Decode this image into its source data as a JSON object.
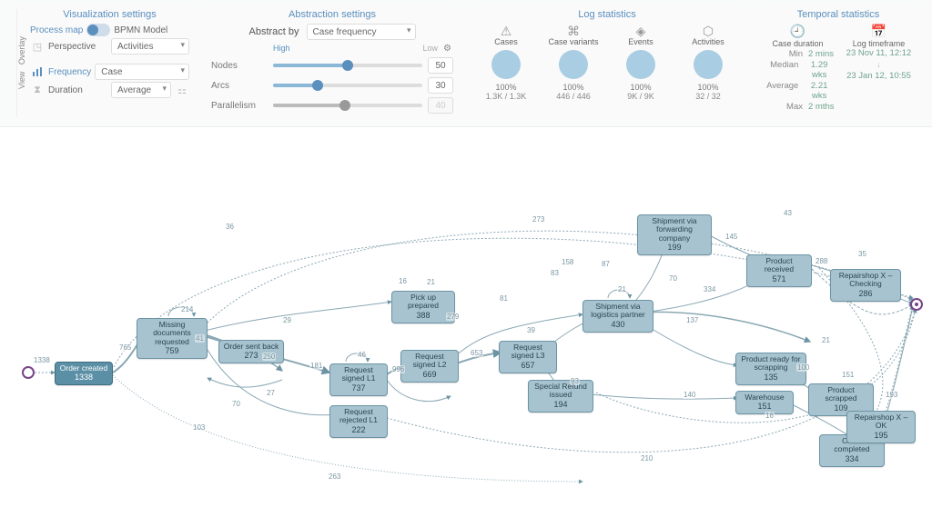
{
  "vis": {
    "title": "Visualization settings",
    "process_map": "Process map",
    "bpmn_model": "BPMN Model",
    "perspective_label": "Perspective",
    "perspective_value": "Activities",
    "view_tab": "View",
    "overlay_tab": "Overlay",
    "frequency": "Frequency",
    "frequency_value": "Case",
    "duration": "Duration",
    "duration_value": "Average"
  },
  "abs": {
    "title": "Abstraction settings",
    "abstract_by": "Abstract by",
    "abstract_value": "Case frequency",
    "scale_high": "High",
    "scale_low": "Low",
    "nodes": "Nodes",
    "nodes_val": "50",
    "arcs": "Arcs",
    "arcs_val": "30",
    "parallelism": "Parallelism",
    "parallelism_val": "40"
  },
  "log": {
    "title": "Log statistics",
    "stats": [
      {
        "name": "Cases",
        "pct": "100%",
        "frac": "1.3K / 1.3K"
      },
      {
        "name": "Case variants",
        "pct": "100%",
        "frac": "446 / 446"
      },
      {
        "name": "Events",
        "pct": "100%",
        "frac": "9K / 9K"
      },
      {
        "name": "Activities",
        "pct": "100%",
        "frac": "32 / 32"
      }
    ]
  },
  "temp": {
    "title": "Temporal statistics",
    "case_duration": "Case duration",
    "log_timeframe": "Log timeframe",
    "dur_kv": [
      {
        "k": "Min",
        "v": "2 mins"
      },
      {
        "k": "Median",
        "v": "1.29 wks"
      },
      {
        "k": "Average",
        "v": "2.21 wks"
      },
      {
        "k": "Max",
        "v": "2 mths"
      }
    ],
    "timeframe_start": "23 Nov 11, 12:12",
    "timeframe_end": "23 Jan 12, 10:55"
  },
  "start_count": "1338",
  "nodes": {
    "order_created": {
      "t": "Order created",
      "c": "1338"
    },
    "missing_docs": {
      "t": "Missing documents requested",
      "c": "759"
    },
    "order_sent_back": {
      "t": "Order sent back",
      "c": "273"
    },
    "request_signed_l1": {
      "t": "Request signed L1",
      "c": "737"
    },
    "request_rejected_l1": {
      "t": "Request rejected L1",
      "c": "222"
    },
    "pick_up_prepared": {
      "t": "Pick up prepared",
      "c": "388"
    },
    "request_signed_l2": {
      "t": "Request signed L2",
      "c": "669"
    },
    "request_signed_l3": {
      "t": "Request signed L3",
      "c": "657"
    },
    "special_refund": {
      "t": "Special Refund issued",
      "c": "194"
    },
    "ship_forwarding": {
      "t": "Shipment via forwarding company",
      "c": "199"
    },
    "ship_logistics": {
      "t": "Shipment via logistics partner",
      "c": "430"
    },
    "product_received": {
      "t": "Product received",
      "c": "571"
    },
    "repairshop_checking": {
      "t": "Repairshop X – Checking",
      "c": "286"
    },
    "product_ready_scrap": {
      "t": "Product ready for scrapping",
      "c": "135"
    },
    "warehouse": {
      "t": "Warehouse",
      "c": "151"
    },
    "product_scrapped": {
      "t": "Product scrapped",
      "c": "109"
    },
    "order_completed": {
      "t": "Order completed",
      "c": "334"
    },
    "repairshop_ok": {
      "t": "Repairshop X – OK",
      "c": "195"
    }
  },
  "edge_labels": {
    "e1": "765",
    "e2": "214",
    "e3": "250",
    "e4": "181",
    "e5": "41",
    "e6": "29",
    "e7": "27",
    "e8": "996",
    "e9": "46",
    "e10": "653",
    "e11": "279",
    "e12": "70",
    "e13": "103",
    "e14": "263",
    "e15": "36",
    "e16": "16",
    "e17": "21",
    "e18": "81",
    "e19": "273",
    "e20": "83",
    "e21": "158",
    "e22": "21",
    "e23": "87",
    "e24": "145",
    "e25": "70",
    "e26": "334",
    "e27": "93",
    "e28": "288",
    "e29": "140",
    "e30": "137",
    "e31": "16",
    "e32": "100",
    "e33": "151",
    "e34": "193",
    "e35": "21",
    "e36": "35",
    "e37": "43",
    "e38": "39",
    "e39": "210"
  }
}
